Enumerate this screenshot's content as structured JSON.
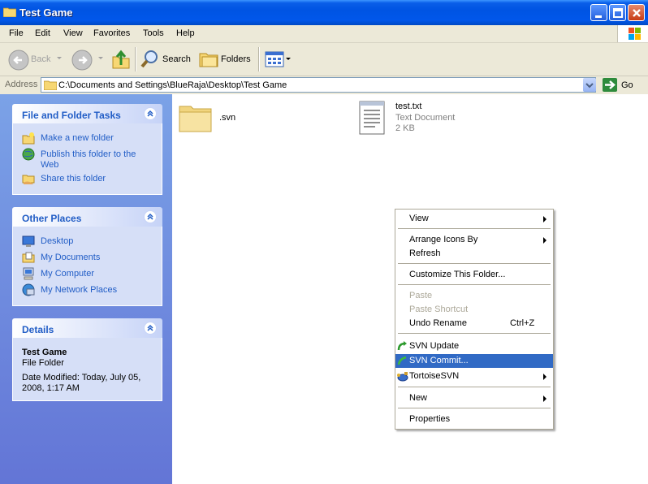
{
  "window": {
    "title": "Test Game"
  },
  "menu": [
    "File",
    "Edit",
    "View",
    "Favorites",
    "Tools",
    "Help"
  ],
  "toolbar": {
    "back": "Back",
    "search": "Search",
    "folders": "Folders"
  },
  "address": {
    "label": "Address",
    "path": "C:\\Documents and Settings\\BlueRaja\\Desktop\\Test Game",
    "go": "Go"
  },
  "tasks": {
    "title": "File and Folder Tasks",
    "items": [
      "Make a new folder",
      "Publish this folder to the",
      "Web",
      "Share this folder"
    ]
  },
  "places": {
    "title": "Other Places",
    "items": [
      "Desktop",
      "My Documents",
      "My Computer",
      "My Network Places"
    ]
  },
  "details": {
    "title": "Details",
    "name": "Test Game",
    "type": "File Folder",
    "modified_line1": "Date Modified: Today, July 05,",
    "modified_line2": "2008, 1:17 AM"
  },
  "files": [
    {
      "name": ".svn"
    },
    {
      "name": "test.txt",
      "type": "Text Document",
      "size": "2 KB"
    }
  ],
  "context_menu": {
    "view": "View",
    "arrange": "Arrange Icons By",
    "refresh": "Refresh",
    "customize": "Customize This Folder...",
    "paste": "Paste",
    "paste_shortcut": "Paste Shortcut",
    "undo": "Undo Rename",
    "undo_shortcut": "Ctrl+Z",
    "svn_update": "SVN Update",
    "svn_commit": "SVN Commit...",
    "tortoise": "TortoiseSVN",
    "new": "New",
    "properties": "Properties"
  },
  "colors": {
    "titlebar": "#0054e3",
    "link": "#215dc6",
    "highlight": "#316ac5",
    "pane": "#6f8fe0"
  }
}
